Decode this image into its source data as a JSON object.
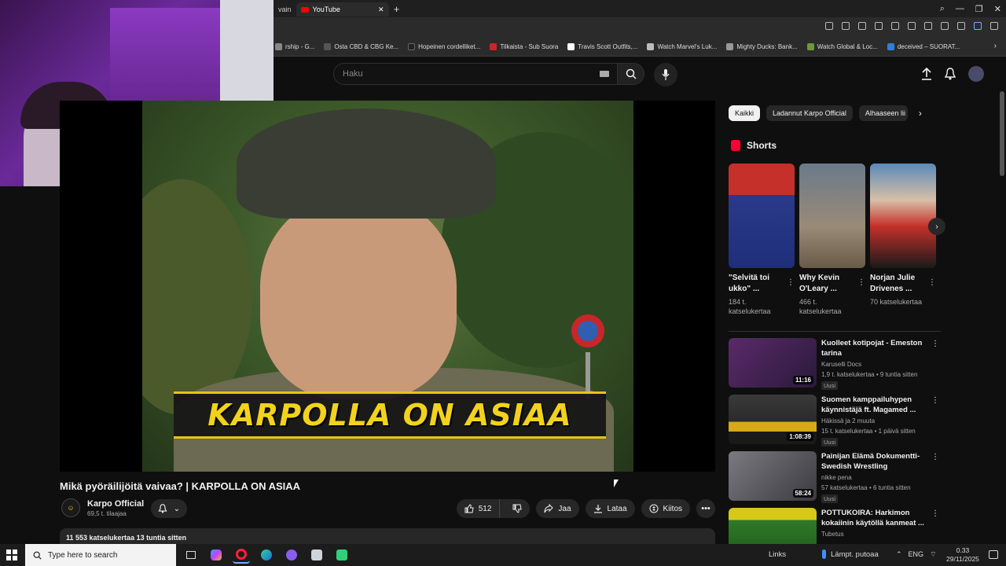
{
  "browser": {
    "tabs": [
      {
        "label": "vain",
        "active": false
      },
      {
        "label": "YouTube",
        "active": true
      }
    ],
    "new_tab": "+",
    "bookmarks": [
      {
        "label": "rship - G...",
        "color": "#888888"
      },
      {
        "label": "Osta CBD & CBG Ke...",
        "color": "#555555"
      },
      {
        "label": "Hopeinen cordelliket...",
        "color": "#222222"
      },
      {
        "label": "Tilkaista - Sub Suora",
        "color": "#c8262a"
      },
      {
        "label": "Travis Scott Outfits,...",
        "color": "#ffffff"
      },
      {
        "label": "Watch Marvel's Luk...",
        "color": "#bbbbbb"
      },
      {
        "label": "Mighty Ducks: Bank...",
        "color": "#999999"
      },
      {
        "label": "Watch Global & Loc...",
        "color": "#6a9a3a"
      },
      {
        "label": "deceived – SUORAT...",
        "color": "#2f7fd8"
      }
    ]
  },
  "masthead": {
    "search_placeholder": "Haku"
  },
  "video": {
    "caption": "KARPOLLA ON ASIAA",
    "title": "Mikä pyöräilijöitä vaivaa? | KARPOLLA ON ASIAA",
    "channel_name": "Karpo Official",
    "channel_subs": "69,5 t. tilaajaa",
    "likes": "512",
    "share_label": "Jaa",
    "download_label": "Lataa",
    "thanks_label": "Kiitos",
    "views_time": "11 553 katselukertaa  13 tuntia sitten"
  },
  "sidebar": {
    "chips": [
      "Kaikki",
      "Ladannut Karpo Official",
      "Alhaaseen lii"
    ],
    "shorts_heading": "Shorts",
    "shorts": [
      {
        "title": "\"Selvitä toi ukko\" ...",
        "views": "184 t. katselukertaa",
        "thumb": "#2a3a8a"
      },
      {
        "title": "Why Kevin O'Leary ...",
        "views": "466 t. katselukertaa",
        "thumb": "#8a8070"
      },
      {
        "title": "Norjan Julie Drivenes ...",
        "views": "70 katselukertaa",
        "thumb": "#c4302a"
      }
    ],
    "recommended": [
      {
        "title": "Kuolleet kotipojat - Emeston tarina",
        "channel": "Karuselli Docs",
        "meta": "1,9 t. katselukertaa • 9 tuntia sitten",
        "badge": "Uusi",
        "duration": "11:16",
        "thumb": "#3a2a4a"
      },
      {
        "title": "Suomen kamppailuhypen käynnistäjä ft. Magamed ...",
        "channel": "Häkissä ja 2 muuta",
        "meta": "15 t. katselukertaa • 1 päivä sitten",
        "badge": "Uusi",
        "duration": "1:08:39",
        "thumb": "#2a2a2a"
      },
      {
        "title": "Painijan Elämä Dokumentti- Swedish Wrestling Document",
        "channel": "nikke pena",
        "meta": "57 katselukertaa • 6 tuntia sitten",
        "badge": "Uusi",
        "duration": "58:24",
        "thumb": "#5a5a60"
      },
      {
        "title": "POTTUKOIRA: Harkimon kokaiinin käytöllä kanmeat ...",
        "channel": "Tubetus",
        "meta": "",
        "badge": "",
        "duration": "",
        "thumb": "#2f7a2a"
      }
    ]
  },
  "taskbar": {
    "search_placeholder": "Type here to search",
    "links_label": "Links",
    "weather": "Lämpt. putoaa",
    "lang": "ENG",
    "time": "0.33",
    "date": "29/11/2025"
  }
}
